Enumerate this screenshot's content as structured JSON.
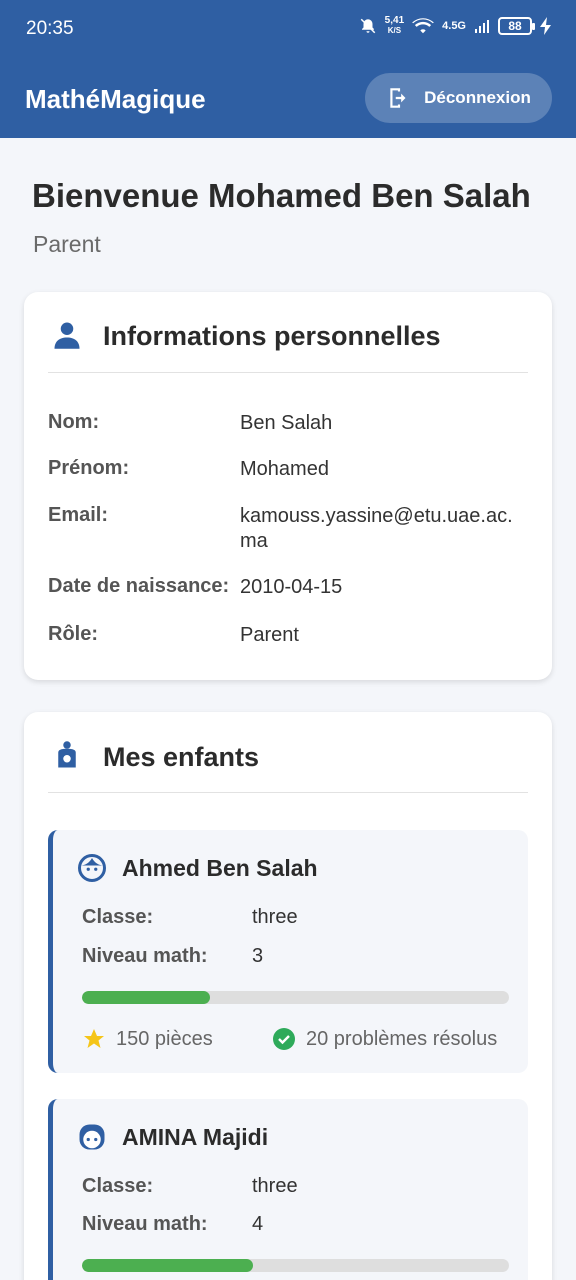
{
  "status_bar": {
    "time": "20:35",
    "net_speed_value": "5,41",
    "net_speed_unit": "K/S",
    "network": "4.5G",
    "battery": "88"
  },
  "app": {
    "title": "MathéMagique",
    "logout_label": "Déconnexion"
  },
  "welcome": {
    "title": "Bienvenue Mohamed Ben Salah",
    "role": "Parent"
  },
  "personal_info": {
    "title": "Informations personnelles",
    "fields": [
      {
        "label": "Nom:",
        "value": "Ben Salah"
      },
      {
        "label": "Prénom:",
        "value": "Mohamed"
      },
      {
        "label": "Email:",
        "value": "kamouss.yassine@etu.uae.ac.ma"
      },
      {
        "label": "Date de naissance:",
        "value": "2010-04-15"
      },
      {
        "label": "Rôle:",
        "value": "Parent"
      }
    ]
  },
  "children": {
    "title": "Mes enfants",
    "class_label": "Classe:",
    "level_label": "Niveau math:",
    "items": [
      {
        "name": "Ahmed Ben Salah",
        "class": "three",
        "level": "3",
        "progress": 0.3,
        "coins": "150 pièces",
        "solved": "20 problèmes résolus"
      },
      {
        "name": "AMINA Majidi",
        "class": "three",
        "level": "4",
        "progress": 0.4
      }
    ]
  },
  "colors": {
    "primary": "#2f5fa3",
    "progress": "#4caf50",
    "star": "#f5c518",
    "check": "#2eaa5a"
  }
}
